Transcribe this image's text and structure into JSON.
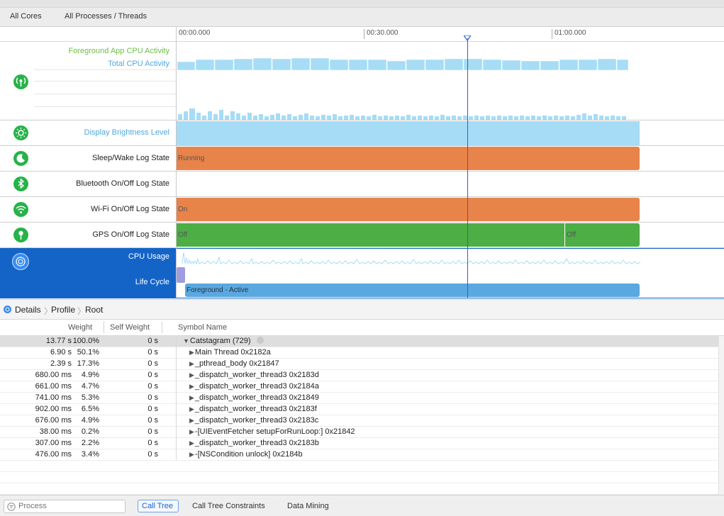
{
  "tabs": {
    "all_cores": "All Cores",
    "all_processes": "All Processes / Threads"
  },
  "ruler": {
    "ticks": [
      "00:00.000",
      "00:30.000",
      "01:00.000"
    ]
  },
  "tracks": {
    "foreground_cpu": "Foreground App CPU Activity",
    "total_cpu": "Total CPU Activity",
    "display_brightness": "Display Brightness Level",
    "sleep_wake": "Sleep/Wake Log State",
    "sleep_wake_value": "Running",
    "bluetooth": "Bluetooth On/Off Log State",
    "wifi": "Wi-Fi On/Off Log State",
    "wifi_value": "On",
    "gps": "GPS On/Off Log State",
    "gps_value_1": "Off",
    "gps_value_2": "Off",
    "cpu_usage": "CPU Usage",
    "life_cycle": "Life Cycle",
    "life_cycle_value": "Foreground - Active"
  },
  "colors": {
    "cpu_blue": "#a6dcf6",
    "orange": "#e8834a",
    "green": "#4cae45",
    "selection_blue": "#1464c8",
    "icon_green": "#27b24a"
  },
  "icons": [
    "network-icon",
    "brightness-icon",
    "sleep-icon",
    "bluetooth-icon",
    "wifi-icon",
    "gps-icon",
    "cpu-icon"
  ],
  "breadcrumb": {
    "details": "Details",
    "profile": "Profile",
    "root": "Root"
  },
  "table": {
    "headers": {
      "weight": "Weight",
      "self_weight": "Self Weight",
      "symbol": "Symbol Name"
    },
    "rows": [
      {
        "weight": "13.77 s",
        "pct": "100.0%",
        "self": "0 s",
        "symbol": "Catstagram (729)",
        "expanded": true
      },
      {
        "weight": "6.90 s",
        "pct": "50.1%",
        "self": "0 s",
        "symbol": "Main Thread  0x2182a",
        "expanded": false
      },
      {
        "weight": "2.39 s",
        "pct": "17.3%",
        "self": "0 s",
        "symbol": "_pthread_body  0x21847",
        "expanded": false
      },
      {
        "weight": "680.00 ms",
        "pct": "4.9%",
        "self": "0 s",
        "symbol": "_dispatch_worker_thread3  0x2183d",
        "expanded": false
      },
      {
        "weight": "661.00 ms",
        "pct": "4.7%",
        "self": "0 s",
        "symbol": "_dispatch_worker_thread3  0x2184a",
        "expanded": false
      },
      {
        "weight": "741.00 ms",
        "pct": "5.3%",
        "self": "0 s",
        "symbol": "_dispatch_worker_thread3  0x21849",
        "expanded": false
      },
      {
        "weight": "902.00 ms",
        "pct": "6.5%",
        "self": "0 s",
        "symbol": "_dispatch_worker_thread3  0x2183f",
        "expanded": false
      },
      {
        "weight": "676.00 ms",
        "pct": "4.9%",
        "self": "0 s",
        "symbol": "_dispatch_worker_thread3  0x2183c",
        "expanded": false
      },
      {
        "weight": "38.00 ms",
        "pct": "0.2%",
        "self": "0 s",
        "symbol": "-[UIEventFetcher setupForRunLoop:]  0x21842",
        "expanded": false
      },
      {
        "weight": "307.00 ms",
        "pct": "2.2%",
        "self": "0 s",
        "symbol": "_dispatch_worker_thread3  0x2183b",
        "expanded": false
      },
      {
        "weight": "476.00 ms",
        "pct": "3.4%",
        "self": "0 s",
        "symbol": "-[NSCondition unlock]  0x2184b",
        "expanded": false
      }
    ]
  },
  "footer": {
    "search_placeholder": "Process",
    "call_tree": "Call Tree",
    "call_tree_constraints": "Call Tree Constraints",
    "data_mining": "Data Mining"
  }
}
